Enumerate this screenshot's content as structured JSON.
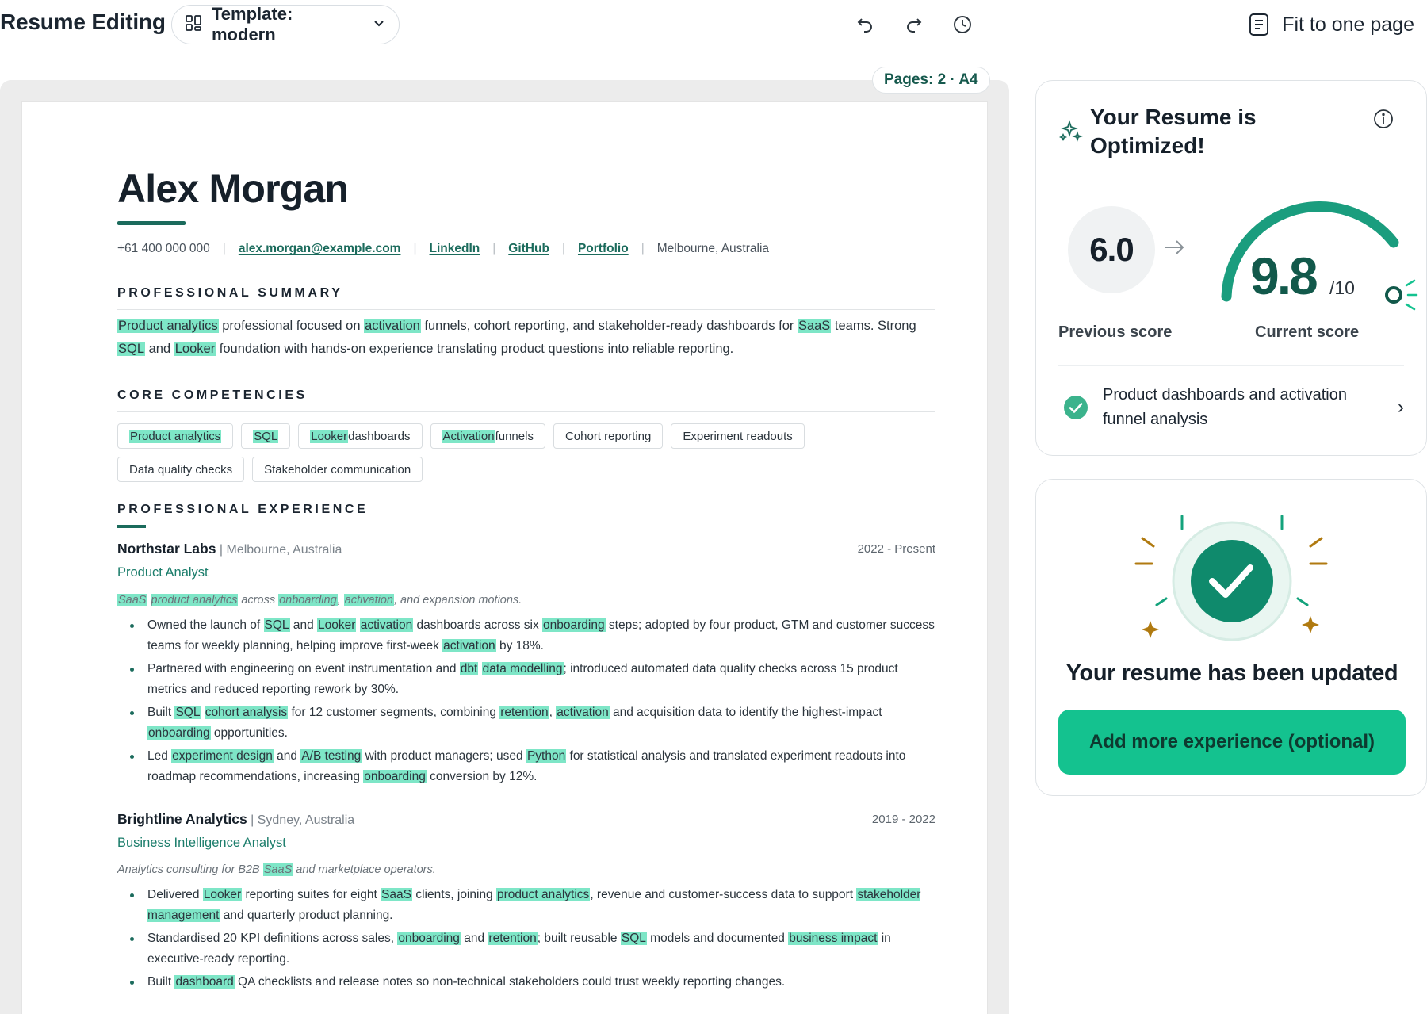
{
  "header": {
    "title": "Resume Editing",
    "template_label": "Template: modern",
    "fit_label": "Fit to one page"
  },
  "pages_badge": "Pages: 2 · A4",
  "resume": {
    "name": "Alex Morgan",
    "contact": {
      "phone": "+61 400 000 000",
      "email": "alex.morgan@example.com",
      "linkedin": "LinkedIn",
      "github": "GitHub",
      "portfolio": "Portfolio",
      "location": "Melbourne, Australia"
    },
    "sections": {
      "summary": "PROFESSIONAL SUMMARY",
      "competencies": "CORE COMPETENCIES",
      "experience": "PROFESSIONAL EXPERIENCE"
    },
    "summary_parts": {
      "a": "Product analytics",
      "b": " professional focused on ",
      "c": "activation",
      "d": " funnels, cohort reporting, and stakeholder-ready dashboards for ",
      "e": "SaaS",
      "f": " teams. Strong ",
      "g": "SQL",
      "h": " and ",
      "i": "Looker",
      "j": " foundation with hands-on experience translating product questions into reliable reporting."
    },
    "chips": {
      "c1_hl": "Product analytics",
      "c2_hl": "SQL",
      "c3_hl": "Looker",
      "c3_rest": " dashboards",
      "c4_hl": "Activation",
      "c4_rest": " funnels",
      "c5": "Cohort reporting",
      "c6": "Experiment readouts",
      "c7": "Data quality checks",
      "c8": "Stakeholder communication"
    },
    "job1": {
      "company": "Northstar Labs",
      "location": " | Melbourne, Australia",
      "dates": "2022 - Present",
      "role": "Product Analyst",
      "desc": {
        "a": "SaaS",
        "b": " ",
        "c": "product analytics",
        "d": " across ",
        "e": "onboarding",
        "f": ", ",
        "g": "activation",
        "h": ", and expansion motions."
      },
      "b1": {
        "a": "Owned the launch of ",
        "b": "SQL",
        "c": " and ",
        "d": "Looker",
        "e": " ",
        "f": "activation",
        "g": " dashboards across six ",
        "h": "onboarding",
        "i": " steps; adopted by four product, GTM and customer success teams for weekly planning, helping improve first-week ",
        "j": "activation",
        "k": " by 18%."
      },
      "b2": {
        "a": "Partnered with engineering on event instrumentation and ",
        "b": "dbt",
        "c": " ",
        "d": "data modelling",
        "e": "; introduced automated data quality checks across 15 product metrics and reduced reporting rework by 30%."
      },
      "b3": {
        "a": "Built ",
        "b": "SQL",
        "c": " ",
        "d": "cohort analysis",
        "e": " for 12 customer segments, combining ",
        "f": "retention",
        "g": ", ",
        "h": "activation",
        "i": " and acquisition data to identify the highest-impact ",
        "j": "onboarding",
        "k": " opportunities."
      },
      "b4": {
        "a": "Led ",
        "b": "experiment design",
        "c": " and ",
        "d": "A/B testing",
        "e": " with product managers; used ",
        "f": "Python",
        "g": " for statistical analysis and translated experiment readouts into roadmap recommendations, increasing ",
        "h": "onboarding",
        "i": " conversion by 12%."
      }
    },
    "job2": {
      "company": "Brightline Analytics",
      "location": " | Sydney, Australia",
      "dates": "2019 - 2022",
      "role": "Business Intelligence Analyst",
      "desc": {
        "a": "Analytics consulting for B2B ",
        "b": "SaaS",
        "c": " and marketplace operators."
      },
      "b1": {
        "a": "Delivered ",
        "b": "Looker",
        "c": " reporting suites for eight ",
        "d": "SaaS",
        "e": " clients, joining ",
        "f": "product analytics",
        "g": ", revenue and customer-success data to support ",
        "h": "stakeholder management",
        "i": " and quarterly product planning."
      },
      "b2": {
        "a": "Standardised 20 KPI definitions across sales, ",
        "b": "onboarding",
        "c": " and ",
        "d": "retention",
        "e": "; built reusable ",
        "f": "SQL",
        "g": " models and documented ",
        "h": "business impact",
        "i": " in executive-ready reporting."
      },
      "b3": {
        "a": "Built ",
        "b": "dashboard",
        "c": " QA checklists and release notes so non-technical stakeholders could trust weekly reporting changes."
      }
    }
  },
  "score_card": {
    "title": "Your Resume is Optimized!",
    "previous_score": "6.0",
    "current_score": "9.8",
    "denominator": "/10",
    "current_fraction": 0.98,
    "previous_label": "Previous score",
    "current_label": "Current score",
    "check_item": "Product dashboards and activation funnel analysis"
  },
  "update_card": {
    "title": "Your resume has been updated",
    "button": "Add more experience (optional)"
  },
  "colors": {
    "accent": "#1b6b5c",
    "highlight": "#7ee6c7",
    "button": "#14c28f",
    "gold": "#b07a10"
  }
}
